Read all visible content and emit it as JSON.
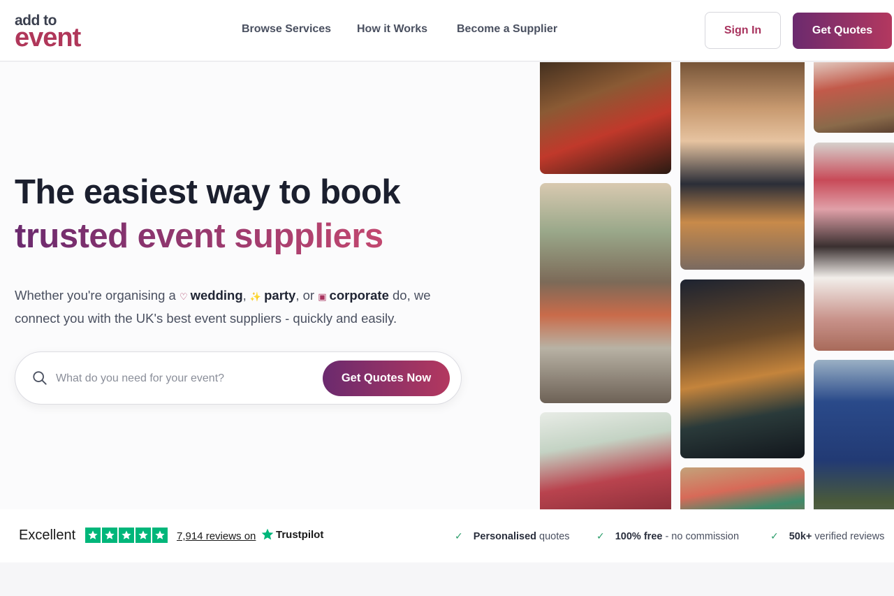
{
  "header": {
    "logo_small": "add to",
    "logo_big": "event",
    "nav": [
      "Browse Services",
      "How it Works",
      "Become a Supplier"
    ],
    "sign_in": "Sign In",
    "get_quotes": "Get Quotes"
  },
  "hero": {
    "headline_line1": "The easiest way to book",
    "headline_line2": "trusted event suppliers",
    "sub_intro": "Whether you're organising a",
    "sub_wedding": "wedding",
    "sub_comma": ",",
    "sub_party": "party",
    "sub_or": ", or",
    "sub_corporate": "corporate",
    "sub_rest": "do, we connect you with the UK's best event suppliers - quickly and easily.",
    "search_placeholder": "What do you need for your event?",
    "search_button": "Get Quotes Now"
  },
  "trust": {
    "rating_word": "Excellent",
    "reviews_link": "7,914 reviews on",
    "brand": "Trustpilot",
    "features": [
      {
        "bold": "Personalised",
        "rest": "quotes"
      },
      {
        "bold": "100% free",
        "rest": "- no commission"
      },
      {
        "bold": "50k+",
        "rest": "verified reviews"
      }
    ]
  },
  "colors": {
    "brand": "#b0375a",
    "gradient_start": "#6b2a6e",
    "gradient_end": "#b3385f",
    "trustpilot_green": "#00b67a"
  }
}
